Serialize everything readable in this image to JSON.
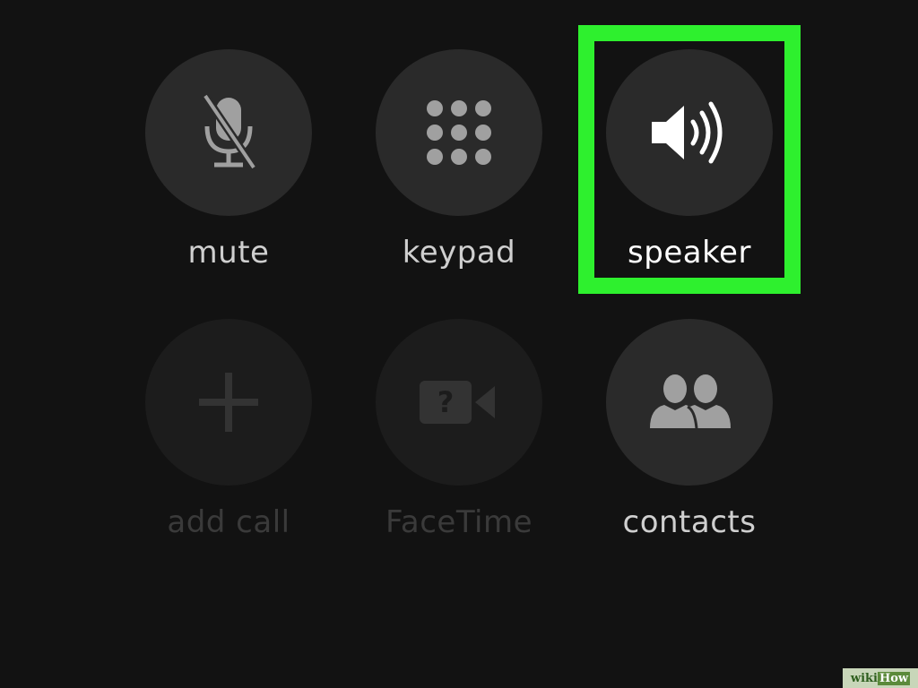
{
  "buttons": {
    "mute": {
      "label": "mute",
      "icon": "mute-microphone-icon",
      "enabled": true
    },
    "keypad": {
      "label": "keypad",
      "icon": "keypad-icon",
      "enabled": true
    },
    "speaker": {
      "label": "speaker",
      "icon": "speaker-icon",
      "enabled": true,
      "highlighted": true
    },
    "add_call": {
      "label": "add call",
      "icon": "plus-icon",
      "enabled": false
    },
    "facetime": {
      "label": "FaceTime",
      "icon": "facetime-video-icon",
      "enabled": false,
      "icon_glyph": "?"
    },
    "contacts": {
      "label": "contacts",
      "icon": "contacts-icon",
      "enabled": true
    }
  },
  "watermark": {
    "part1": "wiki",
    "part2": "How"
  },
  "colors": {
    "highlight": "#2ef02e",
    "button_bg": "#2a2a2a",
    "disabled_button_bg": "#1c1c1c",
    "background": "#121212"
  }
}
